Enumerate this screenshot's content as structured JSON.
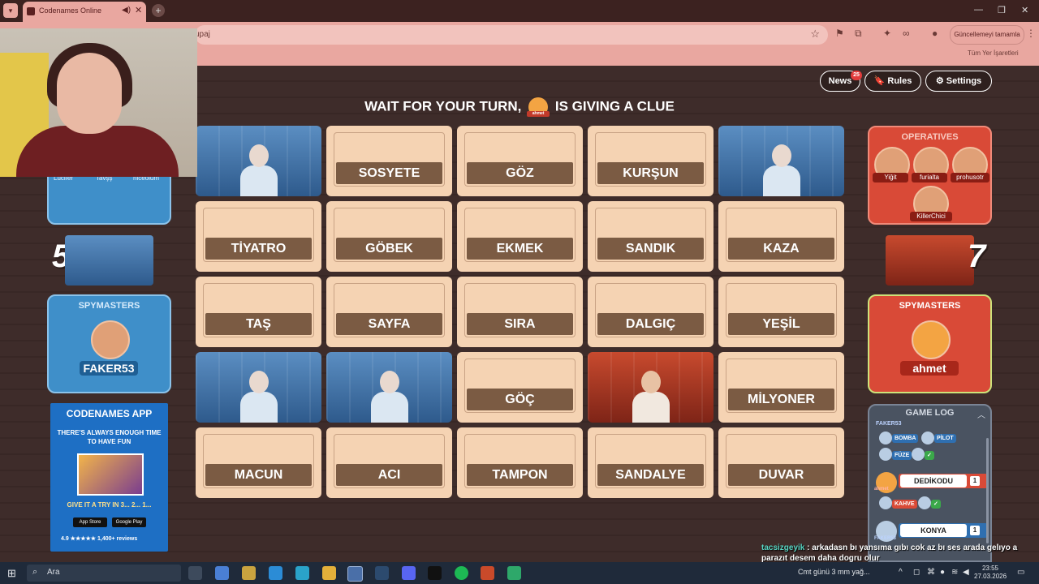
{
  "browser": {
    "tab_title": "Codenames Online",
    "url_fragment": "upaj",
    "update_label": "Güncellemeyi tamamla",
    "bookmarks_label": "Tüm Yer İşaretleri"
  },
  "header": {
    "news_label": "News",
    "news_count": "25",
    "rules_label": "Rules",
    "settings_label": "Settings"
  },
  "status": {
    "text_before": "WAIT FOR YOUR TURN,",
    "clue_giver_badge": "ahmet",
    "text_after": "IS GIVING A CLUE"
  },
  "board": {
    "cards": [
      {
        "word": "",
        "state": "blue"
      },
      {
        "word": "SOSYETE",
        "state": "neutral"
      },
      {
        "word": "GÖZ",
        "state": "neutral"
      },
      {
        "word": "KURŞUN",
        "state": "neutral"
      },
      {
        "word": "",
        "state": "blue"
      },
      {
        "word": "TİYATRO",
        "state": "neutral"
      },
      {
        "word": "GÖBEK",
        "state": "neutral"
      },
      {
        "word": "EKMEK",
        "state": "neutral"
      },
      {
        "word": "SANDIK",
        "state": "neutral"
      },
      {
        "word": "KAZA",
        "state": "neutral"
      },
      {
        "word": "TAŞ",
        "state": "neutral"
      },
      {
        "word": "SAYFA",
        "state": "neutral"
      },
      {
        "word": "SIRA",
        "state": "neutral"
      },
      {
        "word": "DALGIÇ",
        "state": "neutral"
      },
      {
        "word": "YEŞİL",
        "state": "neutral"
      },
      {
        "word": "",
        "state": "blue"
      },
      {
        "word": "",
        "state": "blue"
      },
      {
        "word": "GÖÇ",
        "state": "neutral"
      },
      {
        "word": "",
        "state": "red"
      },
      {
        "word": "MİLYONER",
        "state": "neutral"
      },
      {
        "word": "MACUN",
        "state": "neutral"
      },
      {
        "word": "ACI",
        "state": "neutral"
      },
      {
        "word": "TAMPON",
        "state": "neutral"
      },
      {
        "word": "SANDALYE",
        "state": "neutral"
      },
      {
        "word": "DUVAR",
        "state": "neutral"
      }
    ]
  },
  "blue_team": {
    "remaining": "5",
    "operatives_partial": [
      "Lucifer",
      "Tavşş",
      "niceolum"
    ],
    "spymasters_label": "SPYMASTERS",
    "spymaster": "FAKER53"
  },
  "red_team": {
    "remaining": "7",
    "operatives_label": "OPERATIVES",
    "operatives": [
      "Yiğit",
      "furialta",
      "prohusotr",
      "KillerChici"
    ],
    "spymasters_label": "SPYMASTERS",
    "spymaster": "ahmet"
  },
  "ad": {
    "title": "CODENAMES APP",
    "tagline": "THERE'S ALWAYS ENOUGH TIME TO HAVE FUN",
    "cta": "GIVE IT A TRY IN 3... 2... 1...",
    "app_store": "App Store",
    "google_play": "Google Play",
    "rating": "4.9 ★★★★★ 1,400+ reviews"
  },
  "game_log": {
    "title": "GAME LOG",
    "entries": {
      "top_user": "FAKER53",
      "guess1": "BOMBA",
      "guess2": "PİLOT",
      "guess3": "FÜZE",
      "clue1_user": "ahmet",
      "clue1_word": "DEDİKODU",
      "clue1_num": "1",
      "guess4": "KAHVE",
      "clue2_user": "FAKER53",
      "clue2_word": "KONYA",
      "clue2_num": "1"
    }
  },
  "chat": {
    "user": "tacsizgeyik",
    "message": ": arkadasn bı yansıma gıbı cok az bı ses arada gelıyo a parazıt desem daha dogru olur"
  },
  "taskbar": {
    "search_placeholder": "Ara",
    "weather": "Cmt günü 3 mm yağ...",
    "time": "23:55",
    "date": "27.03.2026"
  },
  "colors": {
    "blue_team": "#3f8fc9",
    "red_team": "#d94a37",
    "card_neutral": "#f5d3b3",
    "card_label": "#7b5b43",
    "board_bg": "#3e2c2a"
  }
}
